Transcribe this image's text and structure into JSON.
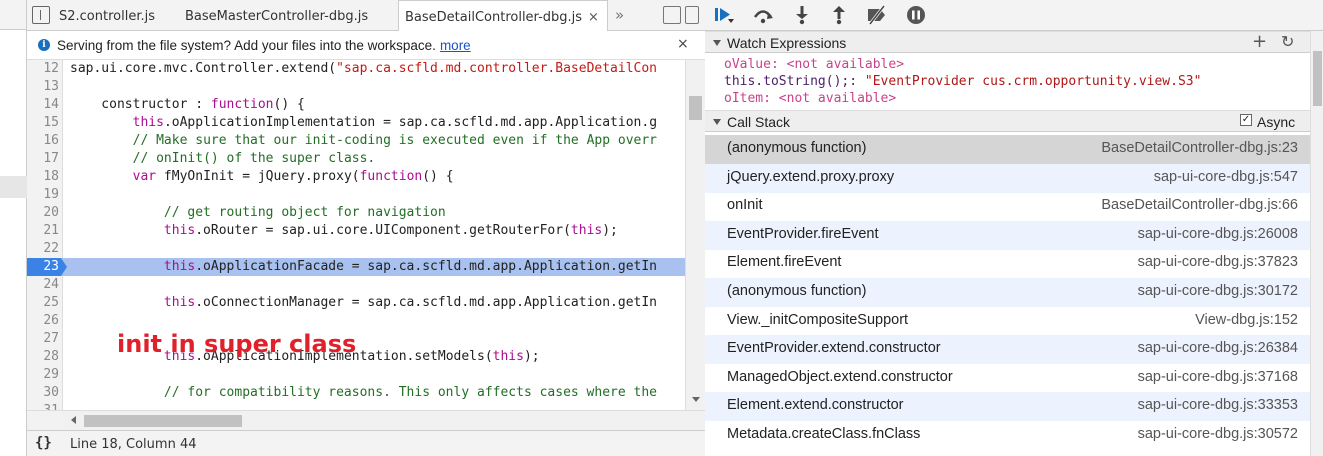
{
  "editor": {
    "tabs": [
      {
        "label": "S2.controller.js"
      },
      {
        "label": "BaseMasterController-dbg.js"
      },
      {
        "label": "BaseDetailController-dbg.js",
        "close": "×"
      }
    ],
    "tab_overflow": "»",
    "infobar": {
      "text": "Serving from the file system? Add your files into the workspace.",
      "link": "more",
      "close": "×"
    },
    "lines": [
      {
        "n": "12",
        "parts": [
          [
            "sap.ui.core.mvc.Controller.extend(",
            ""
          ],
          [
            "\"sap.ca.scfld.md.controller.BaseDetailCon",
            "str"
          ]
        ]
      },
      {
        "n": "13",
        "parts": []
      },
      {
        "n": "14",
        "parts": [
          [
            "    constructor : ",
            ""
          ],
          [
            "function",
            "kw"
          ],
          [
            "() {",
            ""
          ]
        ]
      },
      {
        "n": "15",
        "parts": [
          [
            "        ",
            ""
          ],
          [
            "this",
            "kw"
          ],
          [
            ".oApplicationImplementation = sap.ca.scfld.md.app.Application.g",
            ""
          ]
        ]
      },
      {
        "n": "16",
        "parts": [
          [
            "        ",
            ""
          ],
          [
            "// Make sure that our init-coding is executed even if the App overr",
            "cm"
          ]
        ]
      },
      {
        "n": "17",
        "parts": [
          [
            "        ",
            ""
          ],
          [
            "// onInit() of the super class.",
            "cm"
          ]
        ]
      },
      {
        "n": "18",
        "parts": [
          [
            "        ",
            ""
          ],
          [
            "var",
            "kw"
          ],
          [
            " fMyOnInit = jQuery.proxy(",
            ""
          ],
          [
            "function",
            "kw"
          ],
          [
            "() {",
            ""
          ]
        ]
      },
      {
        "n": "19",
        "parts": []
      },
      {
        "n": "20",
        "parts": [
          [
            "            ",
            ""
          ],
          [
            "// get routing object for navigation",
            "cm"
          ]
        ]
      },
      {
        "n": "21",
        "parts": [
          [
            "            ",
            ""
          ],
          [
            "this",
            "kw"
          ],
          [
            ".oRouter = sap.ui.core.UIComponent.getRouterFor(",
            ""
          ],
          [
            "this",
            "kw"
          ],
          [
            ");",
            ""
          ]
        ]
      },
      {
        "n": "22",
        "parts": []
      },
      {
        "n": "23",
        "highlight": true,
        "parts": [
          [
            "            ",
            ""
          ],
          [
            "this",
            "kw"
          ],
          [
            ".oApplicationFacade = sap.ca.scfld.md.app.Application.getIn",
            ""
          ]
        ]
      },
      {
        "n": "24",
        "parts": []
      },
      {
        "n": "25",
        "parts": [
          [
            "            ",
            ""
          ],
          [
            "this",
            "kw"
          ],
          [
            ".oConnectionManager = sap.ca.scfld.md.app.Application.getIn",
            ""
          ]
        ]
      },
      {
        "n": "26",
        "parts": []
      },
      {
        "n": "27",
        "parts": []
      },
      {
        "n": "28",
        "parts": [
          [
            "            ",
            ""
          ],
          [
            "this",
            "kw"
          ],
          [
            ".oApplicationImplementation.setModels(",
            ""
          ],
          [
            "this",
            "kw"
          ],
          [
            ");",
            ""
          ]
        ]
      },
      {
        "n": "29",
        "parts": []
      },
      {
        "n": "30",
        "parts": [
          [
            "            ",
            ""
          ],
          [
            "// for compatibility reasons. This only affects cases where the",
            "cm"
          ]
        ]
      },
      {
        "n": "31",
        "parts": []
      }
    ],
    "annotation": "init in super class",
    "status": {
      "pretty_print": "{}",
      "position": "Line 18, Column 44"
    }
  },
  "debugger": {
    "icons": [
      "resume-icon",
      "step-over-icon",
      "step-into-icon",
      "step-out-icon",
      "deactivate-breakpoints-icon",
      "pause-on-exceptions-icon"
    ],
    "watch": {
      "title": "Watch Expressions",
      "add": "+",
      "refresh": "↻",
      "rows": [
        {
          "name": "oValue",
          "sep": ": ",
          "value": "<not available>",
          "available": false
        },
        {
          "name": "this.toString();",
          "sep": ": ",
          "value": "\"EventProvider cus.crm.opportunity.view.S3\"",
          "available": true
        },
        {
          "name": "oItem",
          "sep": ": ",
          "value": "<not available>",
          "available": false
        }
      ]
    },
    "callstack": {
      "title": "Call Stack",
      "async_label": "Async",
      "async_checked": true,
      "frames": [
        {
          "fn": "(anonymous function)",
          "loc": "BaseDetailController-dbg.js:23",
          "selected": true
        },
        {
          "fn": "jQuery.extend.proxy.proxy",
          "loc": "sap-ui-core-dbg.js:547"
        },
        {
          "fn": "onInit",
          "loc": "BaseDetailController-dbg.js:66"
        },
        {
          "fn": "EventProvider.fireEvent",
          "loc": "sap-ui-core-dbg.js:26008"
        },
        {
          "fn": "Element.fireEvent",
          "loc": "sap-ui-core-dbg.js:37823"
        },
        {
          "fn": "(anonymous function)",
          "loc": "sap-ui-core-dbg.js:30172"
        },
        {
          "fn": "View._initCompositeSupport",
          "loc": "View-dbg.js:152"
        },
        {
          "fn": "EventProvider.extend.constructor",
          "loc": "sap-ui-core-dbg.js:26384"
        },
        {
          "fn": "ManagedObject.extend.constructor",
          "loc": "sap-ui-core-dbg.js:37168"
        },
        {
          "fn": "Element.extend.constructor",
          "loc": "sap-ui-core-dbg.js:33353"
        },
        {
          "fn": "Metadata.createClass.fnClass",
          "loc": "sap-ui-core-dbg.js:30572"
        }
      ]
    }
  }
}
